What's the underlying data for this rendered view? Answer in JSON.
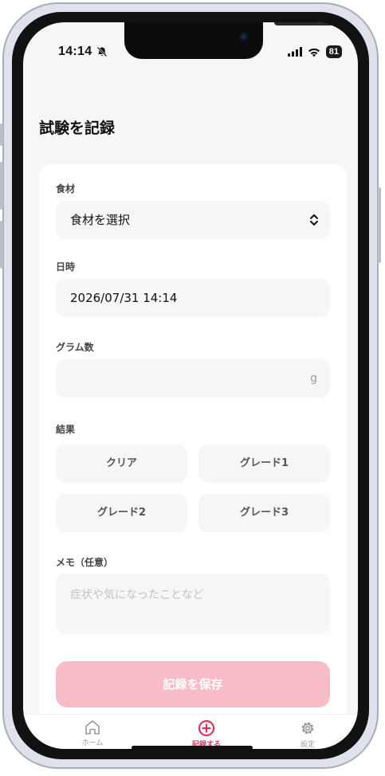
{
  "status_bar": {
    "time": "14:14",
    "battery": "81"
  },
  "page": {
    "title": "試験を記録"
  },
  "form": {
    "ingredient": {
      "label": "食材",
      "value": "食材を選択"
    },
    "datetime": {
      "label": "日時",
      "value": "2026/07/31 14:14"
    },
    "grams": {
      "label": "グラム数",
      "value": "",
      "unit": "g"
    },
    "result": {
      "label": "結果",
      "options": [
        "クリア",
        "グレード1",
        "グレード2",
        "グレード3"
      ]
    },
    "memo": {
      "label": "メモ（任意）",
      "placeholder": "症状や気になったことなど"
    },
    "save_label": "記録を保存"
  },
  "tabbar": {
    "items": [
      {
        "label": "ホーム",
        "icon": "home-icon"
      },
      {
        "label": "記録する",
        "icon": "plus-circle-icon",
        "active": true
      },
      {
        "label": "設定",
        "icon": "gear-icon"
      }
    ]
  },
  "colors": {
    "accent": "#e0335c",
    "save_button_disabled": "#f8bcc7",
    "field_bg": "#f6f6f6"
  }
}
